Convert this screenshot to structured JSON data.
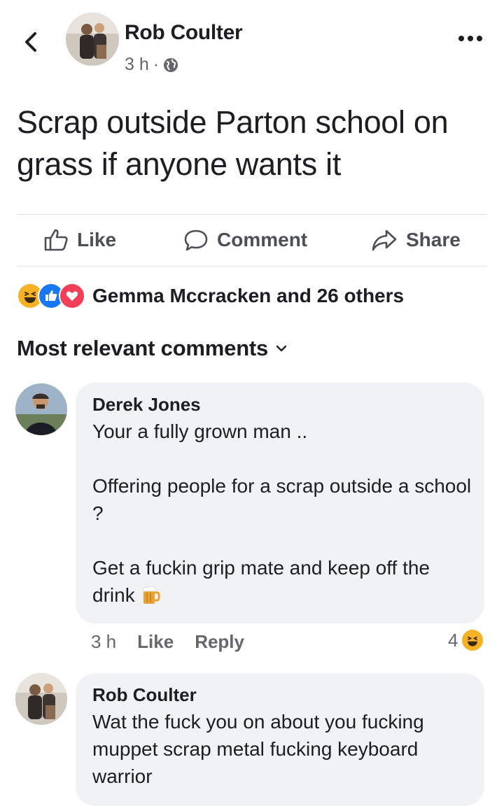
{
  "post": {
    "author": "Rob Coulter",
    "time": "3 h",
    "separator": "·",
    "text": "Scrap outside Parton school on grass if anyone wants it"
  },
  "actions": {
    "like": "Like",
    "comment": "Comment",
    "share": "Share"
  },
  "reactions": {
    "summary": "Gemma Mccracken and 26 others",
    "icons": [
      "haha-icon",
      "like-icon",
      "love-icon"
    ]
  },
  "comments_section": {
    "title": "Most relevant comments"
  },
  "comments": [
    {
      "author": "Derek Jones",
      "text": "Your a fully grown man ..\n\nOffering people for a scrap outside a school ?\n\nGet a fuckin grip mate and keep off the drink",
      "emoji": "beer-mug-icon",
      "time": "3 h",
      "like": "Like",
      "reply": "Reply",
      "reaction_count": "4",
      "reaction_icon": "haha-icon"
    },
    {
      "author": "Rob Coulter",
      "text": "Wat the fuck you on about you fucking muppet scrap metal fucking keyboard warrior"
    }
  ],
  "colors": {
    "text": "#1c1e21",
    "muted": "#65676b",
    "bubble": "#f0f2f5",
    "like_blue": "#1877f2",
    "love_red": "#f33e58",
    "haha_yellow": "#f7b125"
  }
}
